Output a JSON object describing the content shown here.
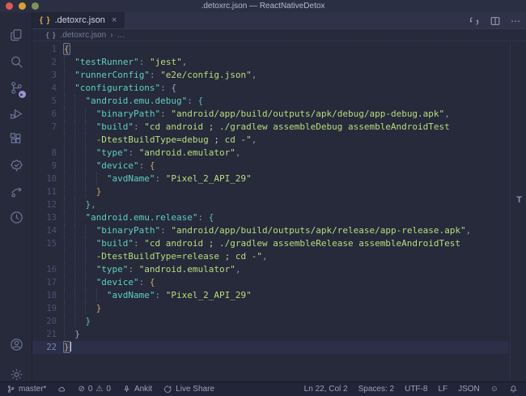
{
  "window": {
    "title": ".detoxrc.json — ReactNativeDetox",
    "traffic_lights": [
      "close",
      "minimize",
      "zoom"
    ]
  },
  "activity_bar": {
    "items": [
      {
        "name": "explorer",
        "icon": "files-icon"
      },
      {
        "name": "search",
        "icon": "search-icon"
      },
      {
        "name": "source-control",
        "icon": "git-branch-icon",
        "badge_dot": true,
        "badge_color": "#a493d8"
      },
      {
        "name": "run-and-debug",
        "icon": "debug-play-icon"
      },
      {
        "name": "extensions",
        "icon": "extensions-icon"
      },
      {
        "name": "approval",
        "icon": "seal-check-icon"
      },
      {
        "name": "live-share-feed",
        "icon": "feed-arrow-icon"
      },
      {
        "name": "history",
        "icon": "clock-icon"
      },
      {
        "name": "account",
        "icon": "account-icon"
      },
      {
        "name": "settings",
        "icon": "gear-icon"
      }
    ]
  },
  "tabs": [
    {
      "label": ".detoxrc.json",
      "icon_glyph": "{ }",
      "close_glyph": "×",
      "active": true
    }
  ],
  "editor_actions": {
    "open_changes": "open-changes-icon",
    "split_editor": "split-editor-icon",
    "more": "⋯"
  },
  "breadcrumb": {
    "icon_glyph": "{ }",
    "file": ".detoxrc.json",
    "separator": "›",
    "more": "…"
  },
  "editor": {
    "language": "json",
    "overview_marker": "T",
    "rows": [
      {
        "n": "1",
        "d": 0,
        "seg": [
          {
            "c": "b1m",
            "t": "{"
          }
        ]
      },
      {
        "n": "2",
        "d": 1,
        "seg": [
          {
            "c": "k",
            "t": "\"testRunner\""
          },
          {
            "c": "p",
            "t": ": "
          },
          {
            "c": "s",
            "t": "\"jest\""
          },
          {
            "c": "p",
            "t": ","
          }
        ]
      },
      {
        "n": "3",
        "d": 1,
        "seg": [
          {
            "c": "k",
            "t": "\"runnerConfig\""
          },
          {
            "c": "p",
            "t": ": "
          },
          {
            "c": "s",
            "t": "\"e2e/config.json\""
          },
          {
            "c": "p",
            "t": ","
          }
        ]
      },
      {
        "n": "4",
        "d": 1,
        "seg": [
          {
            "c": "k",
            "t": "\"configurations\""
          },
          {
            "c": "p",
            "t": ": "
          },
          {
            "c": "b2",
            "t": "{"
          }
        ]
      },
      {
        "n": "5",
        "d": 2,
        "seg": [
          {
            "c": "k",
            "t": "\"android.emu.debug\""
          },
          {
            "c": "p",
            "t": ": "
          },
          {
            "c": "b3",
            "t": "{"
          }
        ]
      },
      {
        "n": "6",
        "d": 3,
        "seg": [
          {
            "c": "k",
            "t": "\"binaryPath\""
          },
          {
            "c": "p",
            "t": ": "
          },
          {
            "c": "s",
            "t": "\"android/app/build/outputs/apk/debug/app-debug.apk\""
          },
          {
            "c": "p",
            "t": ","
          }
        ]
      },
      {
        "n": "7",
        "d": 3,
        "seg": [
          {
            "c": "k",
            "t": "\"build\""
          },
          {
            "c": "p",
            "t": ": "
          },
          {
            "c": "s",
            "t": "\"cd android ; ./gradlew assembleDebug assembleAndroidTest"
          }
        ]
      },
      {
        "n": "",
        "d": 3,
        "seg": [
          {
            "c": "s",
            "t": "-DtestBuildType=debug ; cd -\""
          },
          {
            "c": "p",
            "t": ","
          }
        ]
      },
      {
        "n": "8",
        "d": 3,
        "seg": [
          {
            "c": "k",
            "t": "\"type\""
          },
          {
            "c": "p",
            "t": ": "
          },
          {
            "c": "s",
            "t": "\"android.emulator\""
          },
          {
            "c": "p",
            "t": ","
          }
        ]
      },
      {
        "n": "9",
        "d": 3,
        "seg": [
          {
            "c": "k",
            "t": "\"device\""
          },
          {
            "c": "p",
            "t": ": "
          },
          {
            "c": "b1",
            "t": "{"
          }
        ]
      },
      {
        "n": "10",
        "d": 4,
        "seg": [
          {
            "c": "k",
            "t": "\"avdName\""
          },
          {
            "c": "p",
            "t": ": "
          },
          {
            "c": "s",
            "t": "\"Pixel_2_API_29\""
          }
        ]
      },
      {
        "n": "11",
        "d": 3,
        "seg": [
          {
            "c": "b1",
            "t": "}"
          }
        ]
      },
      {
        "n": "12",
        "d": 2,
        "seg": [
          {
            "c": "b3",
            "t": "}"
          },
          {
            "c": "p",
            "t": ","
          }
        ]
      },
      {
        "n": "13",
        "d": 2,
        "seg": [
          {
            "c": "k",
            "t": "\"android.emu.release\""
          },
          {
            "c": "p",
            "t": ": "
          },
          {
            "c": "b3",
            "t": "{"
          }
        ]
      },
      {
        "n": "14",
        "d": 3,
        "seg": [
          {
            "c": "k",
            "t": "\"binaryPath\""
          },
          {
            "c": "p",
            "t": ": "
          },
          {
            "c": "s",
            "t": "\"android/app/build/outputs/apk/release/app-release.apk\""
          },
          {
            "c": "p",
            "t": ","
          }
        ]
      },
      {
        "n": "15",
        "d": 3,
        "seg": [
          {
            "c": "k",
            "t": "\"build\""
          },
          {
            "c": "p",
            "t": ": "
          },
          {
            "c": "s",
            "t": "\"cd android ; ./gradlew assembleRelease assembleAndroidTest"
          }
        ]
      },
      {
        "n": "",
        "d": 3,
        "seg": [
          {
            "c": "s",
            "t": "-DtestBuildType=release ; cd -\""
          },
          {
            "c": "p",
            "t": ","
          }
        ]
      },
      {
        "n": "16",
        "d": 3,
        "seg": [
          {
            "c": "k",
            "t": "\"type\""
          },
          {
            "c": "p",
            "t": ": "
          },
          {
            "c": "s",
            "t": "\"android.emulator\""
          },
          {
            "c": "p",
            "t": ","
          }
        ]
      },
      {
        "n": "17",
        "d": 3,
        "seg": [
          {
            "c": "k",
            "t": "\"device\""
          },
          {
            "c": "p",
            "t": ": "
          },
          {
            "c": "b1",
            "t": "{"
          }
        ]
      },
      {
        "n": "18",
        "d": 4,
        "seg": [
          {
            "c": "k",
            "t": "\"avdName\""
          },
          {
            "c": "p",
            "t": ": "
          },
          {
            "c": "s",
            "t": "\"Pixel_2_API_29\""
          }
        ]
      },
      {
        "n": "19",
        "d": 3,
        "seg": [
          {
            "c": "b1",
            "t": "}"
          }
        ]
      },
      {
        "n": "20",
        "d": 2,
        "seg": [
          {
            "c": "b3",
            "t": "}"
          }
        ]
      },
      {
        "n": "21",
        "d": 1,
        "seg": [
          {
            "c": "b2",
            "t": "}"
          }
        ]
      },
      {
        "n": "22",
        "d": 0,
        "cur": true,
        "cursor": true,
        "seg": [
          {
            "c": "b1m",
            "t": "}"
          }
        ]
      }
    ]
  },
  "status_bar": {
    "branch": "master*",
    "errors": "0",
    "warnings": "0",
    "user": "Ankit",
    "live_share": "Live Share",
    "line_col": "Ln 22, Col 2",
    "indent": "Spaces: 2",
    "encoding": "UTF-8",
    "eol": "LF",
    "language": "JSON",
    "icons": [
      "git-branch-icon",
      "sync-cloud-icon",
      "error-circle-icon",
      "warning-icon",
      "mic-icon",
      "live-share-icon",
      "feedback-smiley-icon",
      "bell-icon"
    ]
  },
  "colors": {
    "editor_bg": "#262a3b",
    "tabstrip_bg": "#2f3349",
    "titlebar_bg": "#2b2f43",
    "statusbar_bg": "#212537",
    "key": "#5fcfbe",
    "string": "#b8dd7c",
    "brace_gold": "#d0a95e",
    "brace_lavender": "#ab9fc8",
    "brace_teal": "#56c2b1",
    "traffic_red": "#df5a52",
    "traffic_yellow": "#d6a32e",
    "traffic_green": "#7e9457"
  }
}
